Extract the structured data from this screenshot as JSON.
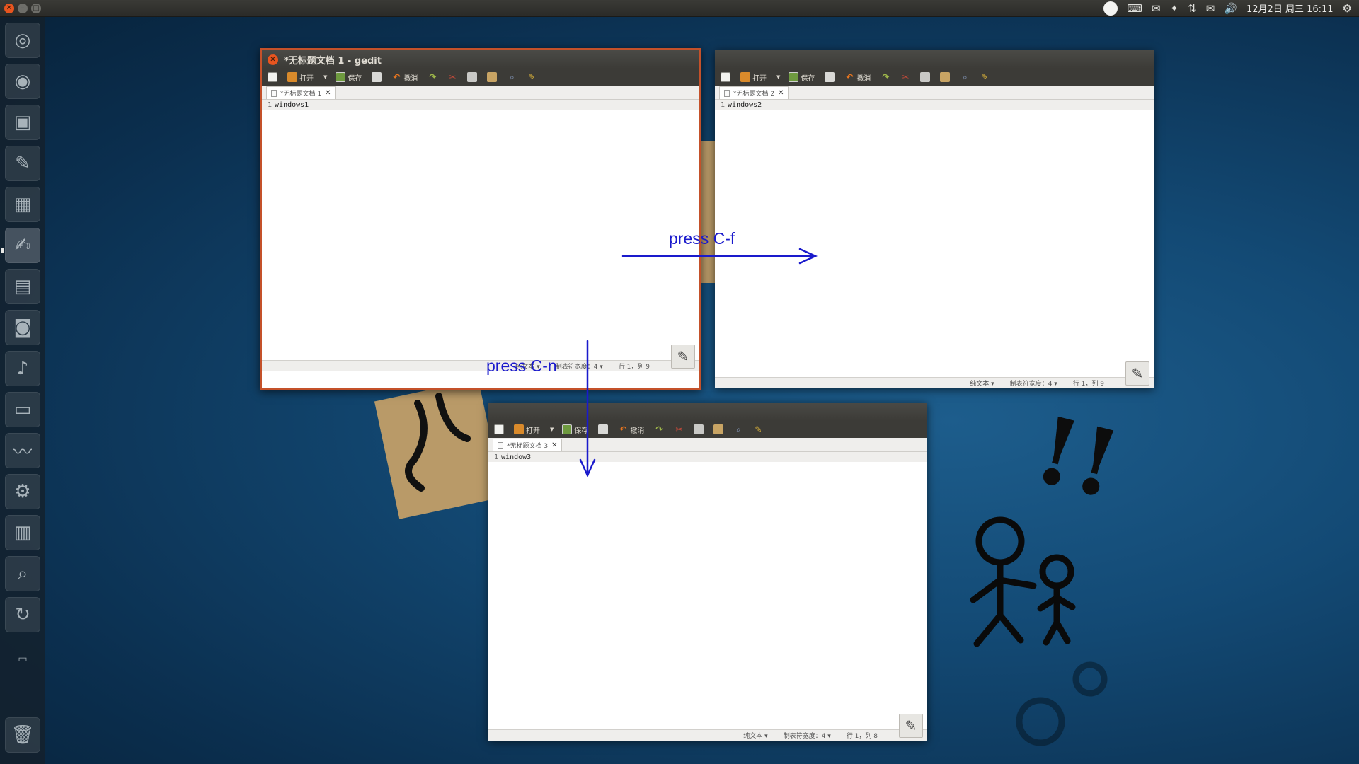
{
  "top_panel": {
    "window_controls": [
      "close-icon",
      "minimize-icon",
      "maximize-icon"
    ],
    "indicators": [
      "user-status-icon",
      "keyboard-icon",
      "chat-icon",
      "dropbox-icon",
      "network-icon",
      "mail-icon",
      "volume-icon"
    ],
    "clock": "12月2日 周三 16:11",
    "settings_icon": "gear-icon"
  },
  "launcher": {
    "items": [
      {
        "name": "dash-home",
        "icon": "ubuntu-logo-icon"
      },
      {
        "name": "chromium",
        "icon": "browser-icon"
      },
      {
        "name": "terminal",
        "icon": "terminal-icon"
      },
      {
        "name": "emacs",
        "icon": "editor-icon"
      },
      {
        "name": "system-monitor",
        "icon": "monitor-icon"
      },
      {
        "name": "gedit",
        "icon": "gedit-icon",
        "active": true
      },
      {
        "name": "files",
        "icon": "folder-icon"
      },
      {
        "name": "camera",
        "icon": "camera-icon"
      },
      {
        "name": "music",
        "icon": "music-icon"
      },
      {
        "name": "video",
        "icon": "film-icon"
      },
      {
        "name": "activity",
        "icon": "activity-icon"
      },
      {
        "name": "system-settings",
        "icon": "settings-icon"
      },
      {
        "name": "mixer",
        "icon": "mixer-icon"
      },
      {
        "name": "screenshot",
        "icon": "screenshot-icon"
      },
      {
        "name": "updater",
        "icon": "update-icon"
      },
      {
        "name": "workspaces",
        "icon": "workspace-icon"
      },
      {
        "name": "trash",
        "icon": "trash-icon"
      }
    ]
  },
  "toolbar": {
    "open_label": "打开",
    "save_label": "保存",
    "undo_label": "撤消"
  },
  "windows": [
    {
      "title": "*无标题文档 1 - gedit",
      "tab_label": "*无标题文档 1",
      "line_number": "1",
      "content": "windows1",
      "status": {
        "mode": "纯文本",
        "tab_width": "制表符宽度：4",
        "cursor": "行 1，列 9"
      }
    },
    {
      "tab_label": "*无标题文档 2",
      "line_number": "1",
      "content": "windows2",
      "status": {
        "mode": "纯文本",
        "tab_width": "制表符宽度：4",
        "cursor": "行 1，列 9"
      }
    },
    {
      "tab_label": "*无标题文档 3",
      "line_number": "1",
      "content": "window3",
      "status": {
        "mode": "纯文本",
        "tab_width": "制表符宽度：4",
        "cursor": "行 1，列 8"
      }
    }
  ],
  "annotations": {
    "press_cf": "press C-f",
    "press_cn": "press C-n",
    "color": "#1a1acc"
  },
  "wallpaper": {
    "exclaim": "!!"
  }
}
